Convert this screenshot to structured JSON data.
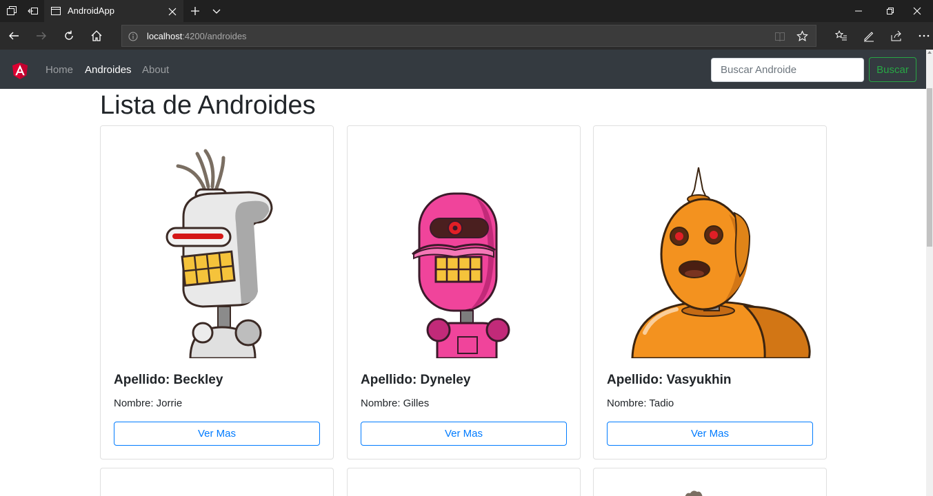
{
  "browser": {
    "tab_title": "AndroidApp",
    "url_host": "localhost",
    "url_rest": ":4200/androides"
  },
  "navbar": {
    "links": [
      {
        "label": "Home"
      },
      {
        "label": "Androides"
      },
      {
        "label": "About"
      }
    ],
    "search_placeholder": "Buscar Androide",
    "search_button": "Buscar"
  },
  "page": {
    "title": "Lista de Androides"
  },
  "androids": [
    {
      "apellido": "Apellido: Beckley",
      "nombre": "Nombre: Jorrie",
      "button": "Ver Mas",
      "color": "#e6e6e6"
    },
    {
      "apellido": "Apellido: Dyneley",
      "nombre": "Nombre: Gilles",
      "button": "Ver Mas",
      "color": "#f0449b"
    },
    {
      "apellido": "Apellido: Vasyukhin",
      "nombre": "Nombre: Tadio",
      "button": "Ver Mas",
      "color": "#f3921f"
    }
  ],
  "colors": {
    "navbar_bg": "#343a40",
    "success": "#28a745",
    "primary": "#007bff",
    "angular_red": "#dd0031"
  }
}
